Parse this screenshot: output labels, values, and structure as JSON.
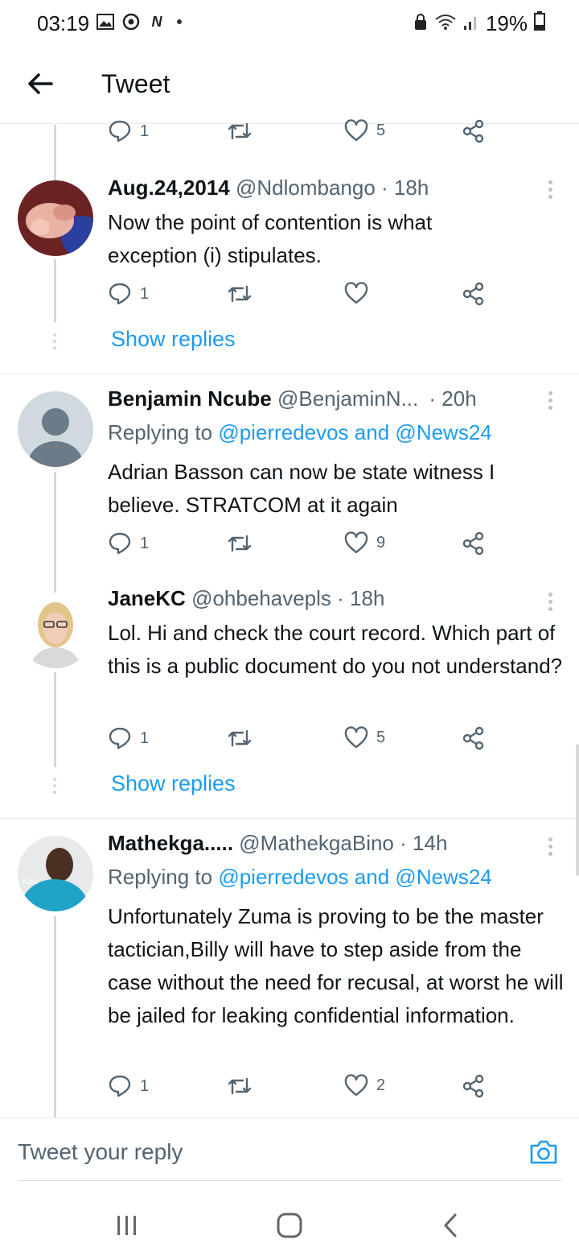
{
  "status_bar": {
    "time": "03:19",
    "battery": "19%",
    "icons": [
      "gallery-icon",
      "chrome-icon",
      "netflix-icon",
      "notification-dot",
      "lock-icon",
      "wifi-icon",
      "signal-icon",
      "battery-icon"
    ]
  },
  "header": {
    "title": "Tweet"
  },
  "top_actions": {
    "reply_count": "1",
    "like_count": "5"
  },
  "tweets": [
    {
      "name": "Aug.24,2014",
      "handle": "@Ndlombango",
      "time": "· 18h",
      "text": "Now the point of contention is what exception (i) stipulates.",
      "reply_count": "1",
      "like_count": "",
      "show_replies": "Show replies"
    },
    {
      "name": "Benjamin Ncube",
      "handle": "@BenjaminN...",
      "time": "· 20h",
      "replying_prefix": "Replying to",
      "replying_mention_1": "@pierredevos",
      "replying_and": "and",
      "replying_mention_2": "@News24",
      "text": "Adrian Basson can now be state witness I believe. STRATCOM at it again",
      "reply_count": "1",
      "like_count": "9"
    },
    {
      "name": "JaneKC",
      "handle": "@ohbehavepls",
      "time": "· 18h",
      "text": "Lol. Hi and check the court record. Which part of this is a public document do you not understand?",
      "reply_count": "1",
      "like_count": "5",
      "show_replies": "Show replies"
    },
    {
      "name": "Mathekga.....",
      "handle": "@MathekgaBino",
      "time": "· 14h",
      "replying_prefix": "Replying to",
      "replying_mention_1": "@pierredevos",
      "replying_and": "and",
      "replying_mention_2": "@News24",
      "text": "Unfortunately Zuma is proving to be the master tactician,Billy will have to step aside from the case without the need for recusal, at worst he will be jailed for leaking confidential information.",
      "reply_count": "1",
      "like_count": "2"
    }
  ],
  "composer": {
    "placeholder": "Tweet your reply"
  },
  "colors": {
    "accent": "#1d9bf0",
    "secondary_text": "#536471",
    "divider": "#e6ecf0"
  }
}
